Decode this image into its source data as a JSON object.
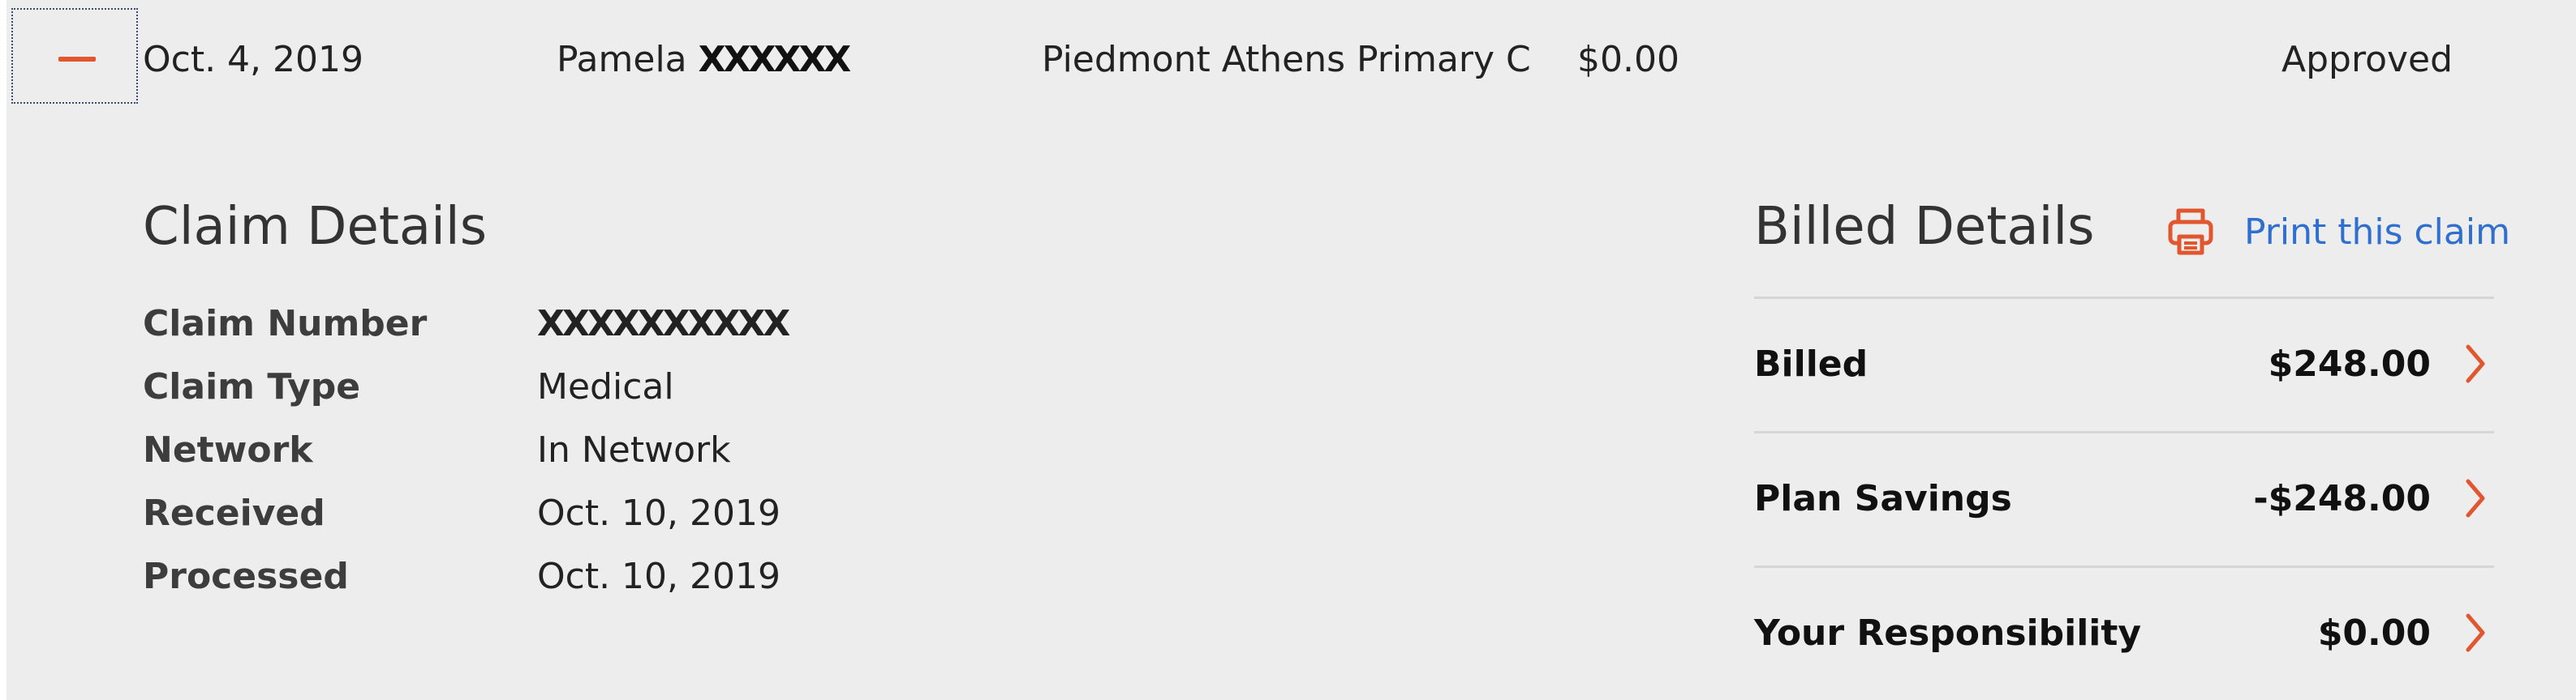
{
  "summary": {
    "date": "Oct. 4, 2019",
    "patient_first": "Pamela",
    "patient_redacted": "XXXXXX",
    "provider": "Piedmont Athens Primary C",
    "amount": "$0.00",
    "status": "Approved"
  },
  "claim_details": {
    "title": "Claim Details",
    "rows": [
      {
        "label": "Claim Number",
        "value": "XXXXXXXXXX"
      },
      {
        "label": "Claim Type",
        "value": "Medical"
      },
      {
        "label": "Network",
        "value": "In Network"
      },
      {
        "label": "Received",
        "value": "Oct. 10, 2019"
      },
      {
        "label": "Processed",
        "value": "Oct. 10, 2019"
      }
    ]
  },
  "billed_details": {
    "title": "Billed Details",
    "print_label": "Print this claim",
    "rows": [
      {
        "label": "Billed",
        "value": "$248.00"
      },
      {
        "label": "Plan Savings",
        "value": "-$248.00"
      },
      {
        "label": "Your Responsibility",
        "value": "$0.00"
      }
    ]
  },
  "icons": {
    "collapse": "minus-icon",
    "print": "printer-icon",
    "row_arrow": "chevron-right-icon"
  },
  "colors": {
    "accent": "#e1562e",
    "link": "#2f6fcf",
    "panel_background": "#ededed"
  }
}
